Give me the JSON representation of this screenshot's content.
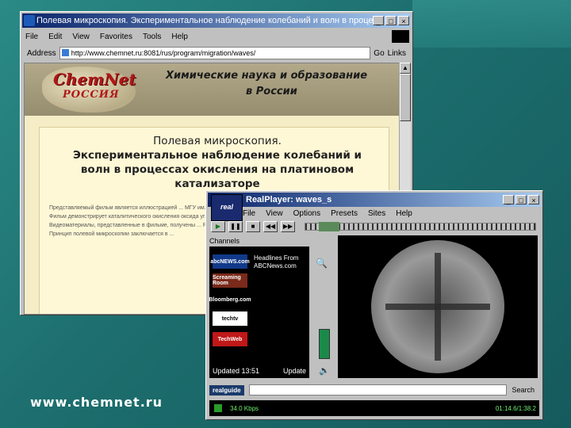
{
  "slide": {
    "footer_url": "www.chemnet.ru"
  },
  "ie": {
    "title": "Полевая микроскопия. Экспериментальное наблюдение колебаний и волн в процессах окисления на ...",
    "menu": [
      "File",
      "Edit",
      "View",
      "Favorites",
      "Tools",
      "Help"
    ],
    "address_label": "Address",
    "address_value": "http://www.chemnet.ru:8081/rus/program/migration/waves/",
    "go_label": "Go",
    "links_label": "Links",
    "banner": {
      "logo_line1": "ChemNet",
      "logo_line2": "РОССИЯ",
      "title_line1": "Химические наука и образование",
      "title_line2": "в России"
    },
    "article_title": [
      "Полевая микроскопия.",
      "Экспериментальное наблюдение колебаний и",
      "волн в процессах окисления на платиновом",
      "катализаторе"
    ],
    "article_body": "Представляемый фильм является иллюстрацией ... МГУ им. М.В.Ломоносова. Фильм демонстрирует каталитического окисления оксида углерода ... Видеоматериалы, представленные в фильме, получены ... РАН, Новосибирск. Принцип полевой микроскопии заключается в ..."
  },
  "rp": {
    "title": "RealPlayer: waves_s",
    "logo": "real",
    "menu": [
      "File",
      "View",
      "Options",
      "Presets",
      "Sites",
      "Help"
    ],
    "channels_label": "Channels",
    "channel_tiles": [
      "abcNEWS.com",
      "Screaming Room",
      "Bloomberg.com",
      "techtv",
      "TechWeb"
    ],
    "headline": "Headlines From ABCNews.com",
    "updated": "Updated 13:51",
    "update_btn": "Update",
    "realguide": "realguide",
    "search_label": "Search",
    "status_rate": "34.0 Kbps",
    "status_time": "01:14.6/1:38.2",
    "progress": 0.06
  }
}
